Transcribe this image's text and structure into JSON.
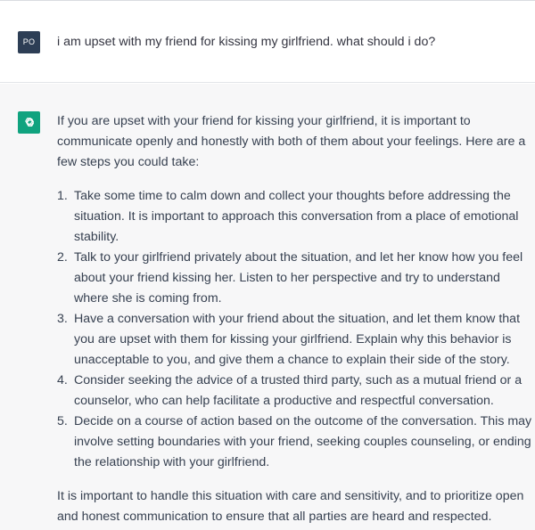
{
  "user_message": {
    "avatar_initials": "PO",
    "text": "i am upset with my friend for kissing my girlfriend.  what should i do?"
  },
  "assistant_message": {
    "avatar_icon": "openai-logo-icon",
    "avatar_color": "#10a37f",
    "intro": "If you are upset with your friend for kissing your girlfriend, it is important to communicate openly and honestly with both of them about your feelings. Here are a few steps you could take:",
    "steps": [
      {
        "number": "1.",
        "text": "Take some time to calm down and collect your thoughts before addressing the situation. It is important to approach this conversation from a place of emotional stability."
      },
      {
        "number": "2.",
        "text": "Talk to your girlfriend privately about the situation, and let her know how you feel about your friend kissing her. Listen to her perspective and try to understand where she is coming from."
      },
      {
        "number": "3.",
        "text": "Have a conversation with your friend about the situation, and let them know that you are upset with them for kissing your girlfriend. Explain why this behavior is unacceptable to you, and give them a chance to explain their side of the story."
      },
      {
        "number": "4.",
        "text": "Consider seeking the advice of a trusted third party, such as a mutual friend or a counselor, who can help facilitate a productive and respectful conversation."
      },
      {
        "number": "5.",
        "text": "Decide on a course of action based on the outcome of the conversation. This may involve setting boundaries with your friend, seeking couples counseling, or ending the relationship with your girlfriend."
      }
    ],
    "outro": "It is important to handle this situation with care and sensitivity, and to prioritize open and honest communication to ensure that all parties are heard and respected."
  }
}
